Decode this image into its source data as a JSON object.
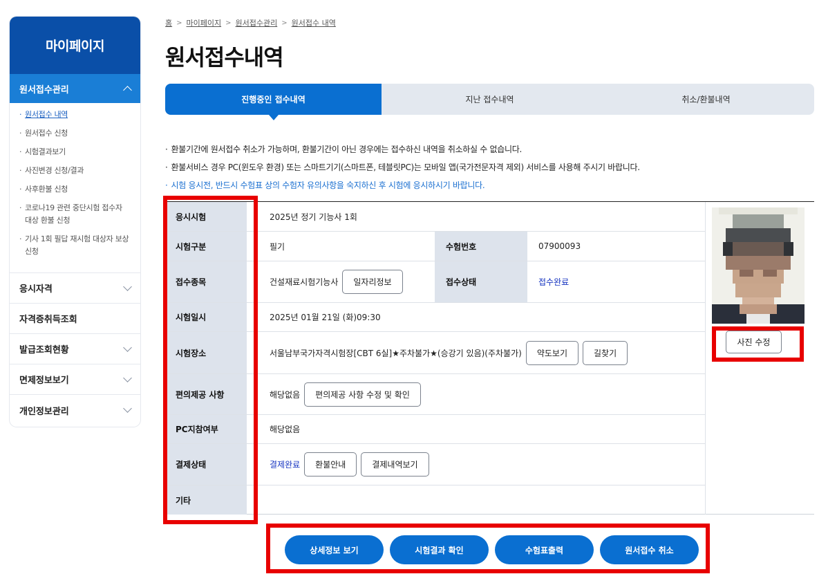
{
  "sidebar": {
    "title": "마이페이지",
    "active_menu": "원서접수관리",
    "sub_items": [
      "원서접수 내역",
      "원서접수 신청",
      "시험결과보기",
      "사진변경 신청/결과",
      "사후환불 신청",
      "코로나19 관련 중단시험 접수자 대상 환불 신청",
      "기사 1회 필답 재시험 대상자 보상 신청"
    ],
    "menus": [
      "응시자격",
      "자격증취득조회",
      "발급조회현황",
      "면제정보보기",
      "개인정보관리"
    ]
  },
  "breadcrumb": [
    "홈",
    "마이페이지",
    "원서접수관리",
    "원서접수 내역"
  ],
  "page_title": "원서접수내역",
  "tabs": [
    "진행중인 접수내역",
    "지난 접수내역",
    "취소/환불내역"
  ],
  "notices": [
    "환불기간에 원서접수 취소가 가능하며, 환불기간이 아닌 경우에는 접수하신 내역을 취소하실 수 없습니다.",
    "환불서비스 경우 PC(윈도우 환경) 또는 스마트기기(스마트폰, 테블릿PC)는 모바일 앱(국가전문자격 제외) 서비스를 사용해 주시기 바랍니다.",
    "시험 응시전, 반드시 수험표 상의 수험자 유의사항을 숙지하신 후 시험에 응시하시기 바랍니다."
  ],
  "table": {
    "exam_label": "응시시험",
    "exam_value": "2025년 정기 기능사 1회",
    "category_label": "시험구분",
    "category_value": "필기",
    "exam_number_label": "수험번호",
    "exam_number_value": "07900093",
    "type_label": "접수종목",
    "type_value": "건설재료시험기능사",
    "job_info_button": "일자리정보",
    "status_label": "접수상태",
    "status_value": "접수완료",
    "date_label": "시험일시",
    "date_value": "2025년 01월 21일 (화)09:30",
    "place_label": "시험장소",
    "place_value": "서울남부국가자격시험장[CBT 6실]★주차불가★(승강기 있음)(주차불가)",
    "map_button": "약도보기",
    "route_button": "길찾기",
    "convenience_label": "편의제공 사항",
    "convenience_value": "해당없음",
    "convenience_button": "편의제공 사항 수정 및 확인",
    "pc_label": "PC지참여부",
    "pc_value": "해당없음",
    "payment_label": "결제상태",
    "payment_value": "결제완료",
    "refund_button": "환불안내",
    "payment_history_button": "결제내역보기",
    "etc_label": "기타",
    "photo_edit_button": "사진 수정"
  },
  "bottom_buttons": [
    "상세정보 보기",
    "시험결과 확인",
    "수험표출력",
    "원서접수 취소"
  ],
  "colors": {
    "brand_dark": "#0a4fa8",
    "brand": "#0a6fd1",
    "highlight": "#e80000",
    "link": "#1533c0"
  }
}
